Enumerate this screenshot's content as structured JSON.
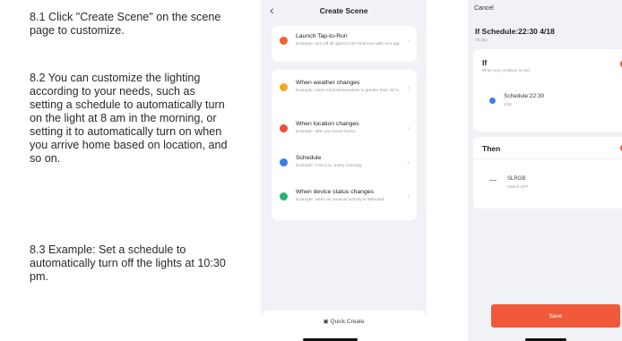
{
  "instructions": {
    "step1": "8.1 Click \"Create Scene\" on the scene page to customize.",
    "step2": "8.2 You can customize the lighting according to your needs, such as setting a schedule to automatically turn on the light at 8 am in the morning, or setting it to automatically turn on when you arrive home based on location, and so on.",
    "step3": "8.3 Example: Set a schedule to automatically turn off the lights at 10:30 pm."
  },
  "create_scene": {
    "back_icon": "chevron-left-icon",
    "title": "Create Scene",
    "options": [
      {
        "title": "Launch Tap-to-Run",
        "desc": "Example: turn off all lights in the bedroom with one tap.",
        "color": "#f2603a"
      },
      {
        "title": "When weather changes",
        "desc": "Example: when local temperature is greater than 28°C.",
        "color": "#f5a623"
      },
      {
        "title": "When location changes",
        "desc": "Example: after you leave home.",
        "color": "#ef4b3f"
      },
      {
        "title": "Schedule",
        "desc": "Example: 7:00 a.m. every morning.",
        "color": "#3d7fe0"
      },
      {
        "title": "When device status changes",
        "desc": "Example: when an unusual activity is detected.",
        "color": "#27b07a"
      }
    ],
    "quick_create": "Quick Create"
  },
  "scene_editor": {
    "cancel": "Cancel",
    "title": "If Schedule:22:30 4/18",
    "subtitle": "All day",
    "if_label": "If",
    "if_desc": "When any condition is met",
    "condition": {
      "title": "Schedule:22:30",
      "sub": "4/18"
    },
    "then_label": "Then",
    "action": {
      "name": "SLRGB",
      "sub": "Switch:OFF"
    },
    "save": "Save",
    "accent_color": "#f05a3a"
  }
}
